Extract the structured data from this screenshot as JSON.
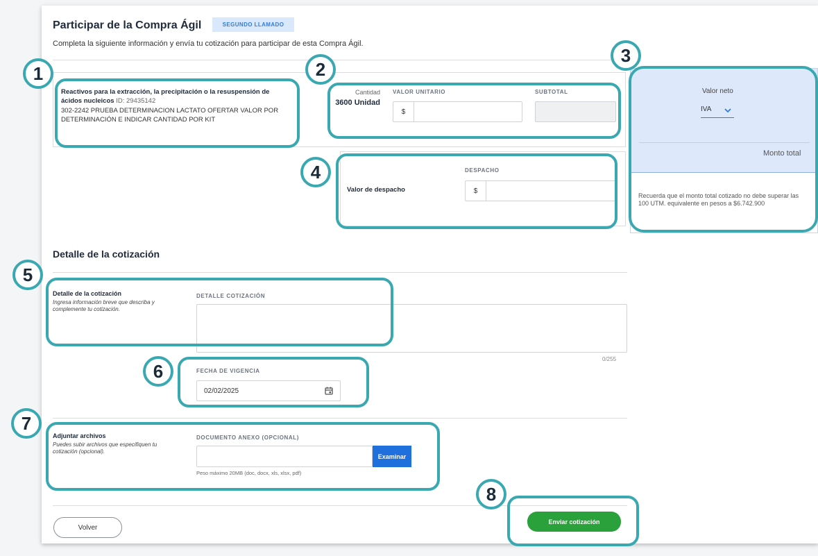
{
  "header": {
    "title": "Participar de la Compra Ágil",
    "badge": "SEGUNDO LLAMADO",
    "subtitle": "Completa la siguiente información y envía tu cotización para participar de esta Compra Ágil."
  },
  "product": {
    "name": "Reactivos para la extracción, la precipitación o la resuspensión de ácidos nucleicos",
    "id": "ID: 29435142",
    "description": "302-2242 PRUEBA DETERMINACION LACTATO OFERTAR VALOR POR DETERMINACIÓN E INDICAR CANTIDAD POR KIT"
  },
  "pricing": {
    "quantity_label": "Cantidad",
    "quantity_value": "3600 Unidad",
    "unit_value_label": "VALOR UNITARIO",
    "subtotal_label": "SUBTOTAL",
    "currency": "$",
    "unit_value": "",
    "subtotal": ""
  },
  "summary": {
    "net_label": "Valor neto",
    "tax_select": "IVA",
    "total_label": "Monto total",
    "note": "Recuerda que el monto total cotizado no debe superar las 100 UTM. equivalente en pesos a $6.742.900"
  },
  "shipping": {
    "row_label": "Valor de despacho",
    "field_label": "DESPACHO",
    "currency": "$",
    "value": ""
  },
  "quote_detail": {
    "section_title": "Detalle de la cotización",
    "label": "Detalle de la cotización",
    "help": "Ingresa información breve que describa y complemente tu cotización.",
    "field_label": "DETALLE COTIZACIÓN",
    "value": "",
    "counter": "0/255"
  },
  "validity": {
    "field_label": "FECHA DE VIGENCIA",
    "value": "02/02/2025"
  },
  "attachments": {
    "label": "Adjuntar archivos",
    "help": "Puedes subir archivos que especifiquen tu cotización (opcional).",
    "field_label": "DOCUMENTO ANEXO (OPCIONAL)",
    "browse_button": "Examinar",
    "hint": "Peso máximo 20MB (doc, docx, xls, xlsx, pdf)"
  },
  "footer": {
    "back_button": "Volver",
    "submit_button": "Enviar cotización"
  },
  "callouts": [
    "1",
    "2",
    "3",
    "4",
    "5",
    "6",
    "7",
    "8"
  ],
  "colors": {
    "accent": "#3aa8b0",
    "primary": "#1f6fdc",
    "success": "#2aa13a",
    "badge_bg": "#d9e8fb",
    "summary_bg": "#dde9fa"
  }
}
